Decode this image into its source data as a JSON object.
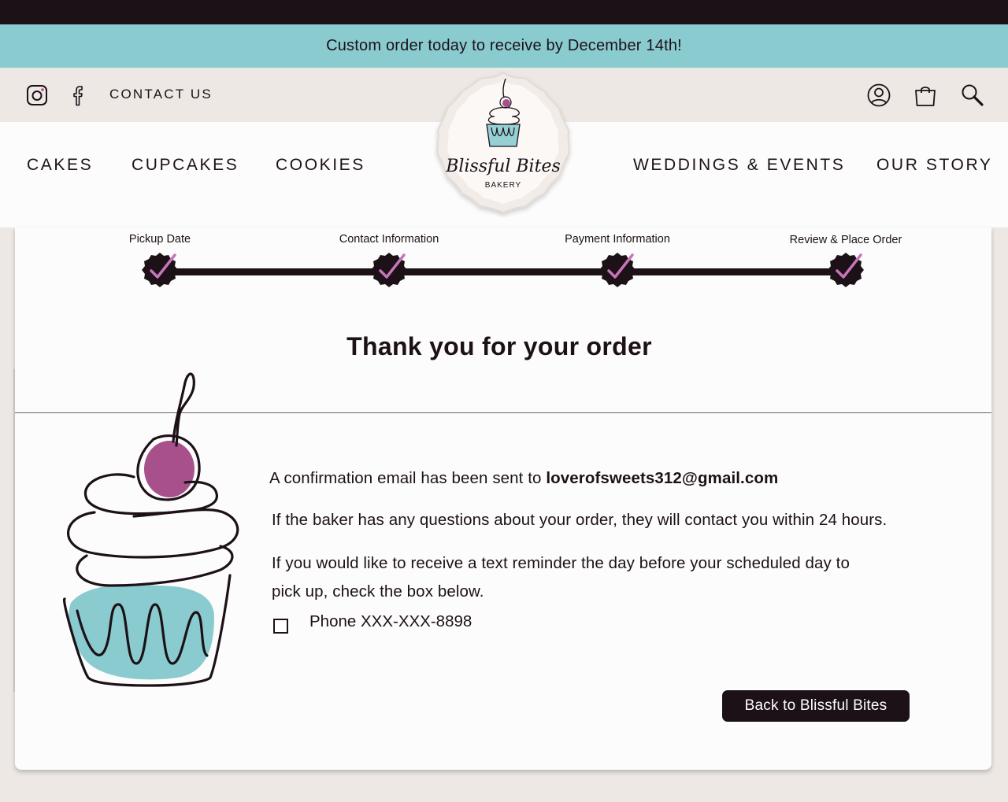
{
  "announcement": "Custom order today to receive by December 14th!",
  "utility": {
    "icons": [
      "instagram-icon",
      "facebook-icon",
      "account-icon",
      "shopping-bag-icon",
      "search-icon"
    ],
    "contact_label": "CONTACT US"
  },
  "nav": {
    "left": [
      "CAKES",
      "CUPCAKES",
      "COOKIES"
    ],
    "right": [
      "WEDDINGS & EVENTS",
      "OUR STORY"
    ]
  },
  "logo": {
    "name": "Blissful Bites",
    "subtitle": "BAKERY"
  },
  "steps": [
    {
      "label": "Pickup Date",
      "complete": true
    },
    {
      "label": "Contact Information",
      "complete": true
    },
    {
      "label": "Payment Information",
      "complete": true
    },
    {
      "label": "Review & Place Order",
      "complete": true
    }
  ],
  "confirmation": {
    "title": "Thank you for your order",
    "email_prefix": "A confirmation email has been sent to",
    "email": "loverofsweets312@gmail.com",
    "questions_text": "If the baker has any questions about your order, they will contact you within 24 hours.",
    "reminder_line1": "If you would like to receive a text reminder the day before your scheduled day to",
    "reminder_line2": "pick up, check the box below.",
    "phone_label": "Phone XXX-XXX-8898",
    "phone_checked": false,
    "back_button": "Back to Blissful Bites"
  },
  "colors": {
    "dark": "#1b1117",
    "teal": "#8acbd0",
    "cream": "#ede8e4",
    "magenta": "#a8508c",
    "check_pink": "#c874b8"
  }
}
